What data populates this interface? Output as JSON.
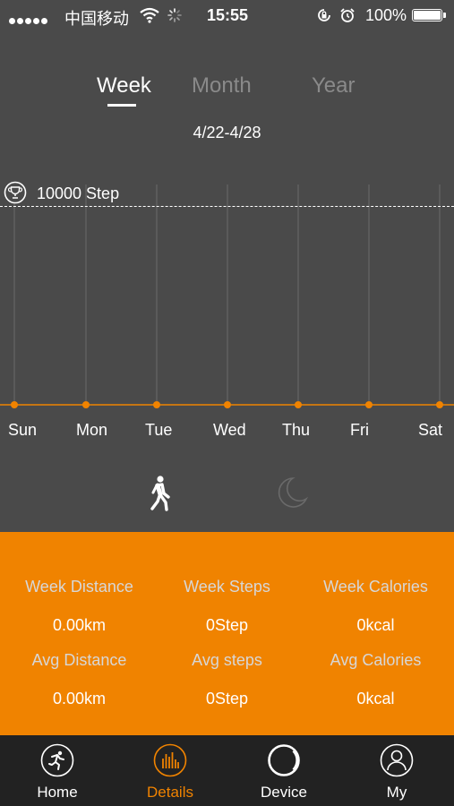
{
  "status_bar": {
    "carrier": "中国移动",
    "time": "15:55",
    "battery_percent": "100%",
    "battery_level": 1.0,
    "signal_dots": 5
  },
  "period_tabs": {
    "items": [
      {
        "label": "Week",
        "active": true
      },
      {
        "label": "Month",
        "active": false
      },
      {
        "label": "Year",
        "active": false
      }
    ]
  },
  "date_range": "4/22-4/28",
  "goal": {
    "label": "10000 Step",
    "icon": "trophy-icon"
  },
  "chart_data": {
    "type": "line",
    "categories": [
      "Sun",
      "Mon",
      "Tue",
      "Wed",
      "Thu",
      "Fri",
      "Sat"
    ],
    "series": [
      {
        "values": [
          0,
          0,
          0,
          0,
          0,
          0,
          0
        ]
      }
    ],
    "goal_value": 10000,
    "ylim": [
      0,
      10000
    ],
    "grid": true,
    "colors": {
      "line": "#f08300",
      "grid": "#6a6a6a"
    }
  },
  "mode_switch": {
    "walk_icon": "walking-person-icon",
    "sleep_icon": "moon-icon"
  },
  "stats": {
    "week_distance_label": "Week Distance",
    "week_steps_label": "Week Steps",
    "week_calories_label": "Week Calories",
    "week_distance_value": "0.00km",
    "week_steps_value": "0Step",
    "week_calories_value": "0kcal",
    "avg_distance_label": "Avg Distance",
    "avg_steps_label": "Avg steps",
    "avg_calories_label": "Avg Calories",
    "avg_distance_value": "0.00km",
    "avg_steps_value": "0Step",
    "avg_calories_value": "0kcal"
  },
  "tabbar": {
    "items": [
      {
        "label": "Home",
        "icon": "runner-icon",
        "active": false
      },
      {
        "label": "Details",
        "icon": "bar-chart-icon",
        "active": true
      },
      {
        "label": "Device",
        "icon": "device-circle-icon",
        "active": false
      },
      {
        "label": "My",
        "icon": "person-icon",
        "active": false
      }
    ]
  },
  "colors": {
    "accent": "#f08300",
    "background": "#4a4a4a",
    "tabbar_bg": "#222222"
  }
}
